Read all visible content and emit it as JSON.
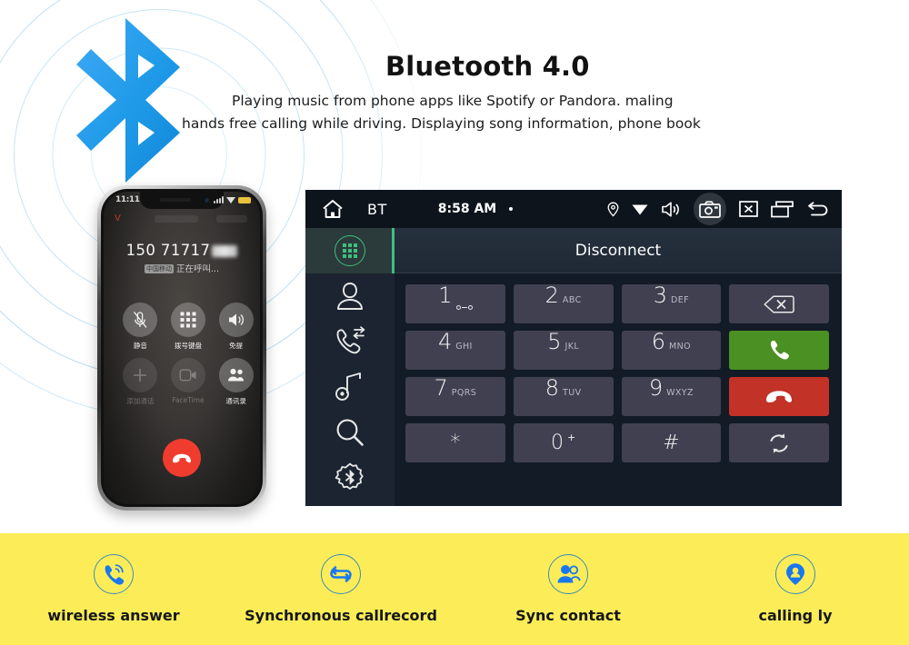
{
  "hero": {
    "title": "Bluetooth 4.0",
    "desc_line1": "Playing music from phone apps like Spotify or Pandora. maling",
    "desc_line2": "hands free calling while driving. Displaying  song information, phone book",
    "logo_icon": "bluetooth-logo-icon",
    "accent_blue": "#2196f3",
    "ring_color": "#bfe3f5"
  },
  "phone": {
    "status": {
      "time": "11:11",
      "carrier_mark": "V",
      "battery_color": "#e8c33c"
    },
    "call": {
      "number": "150 71717",
      "number_masked": true,
      "status_tag": "中国移动",
      "status_text": "正在呼叫...",
      "end_call_icon": "end-call-icon",
      "end_call_color": "#f03c2e"
    },
    "buttons": [
      {
        "label": "静音",
        "icon": "mute-icon",
        "dim": false
      },
      {
        "label": "拨号键盘",
        "icon": "keypad-icon",
        "dim": false
      },
      {
        "label": "免提",
        "icon": "speaker-icon",
        "dim": false
      },
      {
        "label": "添加通话",
        "icon": "add-call-icon",
        "dim": true
      },
      {
        "label": "FaceTime",
        "icon": "facetime-icon",
        "dim": true
      },
      {
        "label": "通讯录",
        "icon": "contacts-icon",
        "dim": false
      }
    ]
  },
  "headunit": {
    "topbar": {
      "home_icon": "home-icon",
      "source_label": "BT",
      "time": "8:58 AM",
      "dot": "•",
      "icons": [
        "location-pin-icon",
        "wifi-icon",
        "volume-icon",
        "camera-icon",
        "close-box-icon",
        "recent-apps-icon",
        "back-arrow-icon"
      ]
    },
    "sidebar": [
      {
        "name": "dialpad",
        "icon": "dialpad-icon",
        "active": true
      },
      {
        "name": "contacts",
        "icon": "contact-icon",
        "active": false
      },
      {
        "name": "call-history",
        "icon": "call-history-icon",
        "active": false
      },
      {
        "name": "music",
        "icon": "music-note-icon",
        "active": false
      },
      {
        "name": "search",
        "icon": "search-icon",
        "active": false
      },
      {
        "name": "bluetooth-settings",
        "icon": "bluetooth-gear-icon",
        "active": false
      }
    ],
    "header_title": "Disconnect",
    "keys": [
      {
        "num": "1",
        "sub": "",
        "voicemail": true
      },
      {
        "num": "2",
        "sub": "ABC"
      },
      {
        "num": "3",
        "sub": "DEF"
      },
      {
        "type": "action",
        "icon": "backspace-icon"
      },
      {
        "num": "4",
        "sub": "GHI"
      },
      {
        "num": "5",
        "sub": "JKL"
      },
      {
        "num": "6",
        "sub": "MNO"
      },
      {
        "type": "green",
        "icon": "call-icon"
      },
      {
        "num": "7",
        "sub": "PQRS"
      },
      {
        "num": "8",
        "sub": "TUV"
      },
      {
        "num": "9",
        "sub": "WXYZ"
      },
      {
        "type": "red",
        "icon": "hangup-icon"
      },
      {
        "num": "*",
        "sub": "",
        "symbol": true
      },
      {
        "num": "0",
        "sup": "+",
        "symbol": true
      },
      {
        "num": "#",
        "sub": "",
        "symbol": true
      },
      {
        "type": "action",
        "icon": "sync-icon"
      }
    ],
    "colors": {
      "background": "#121b26",
      "topbar": "#0d141c",
      "sidebar": "#1b2430",
      "key": "#414050",
      "accent_green": "#3fbf7f",
      "call_green": "#4a9022",
      "hangup_red": "#c23226"
    }
  },
  "features": {
    "background": "#fced58",
    "icon_color": "#1878f0",
    "items": [
      {
        "label": "wireless answer",
        "icon": "wireless-call-icon"
      },
      {
        "label": "Synchronous callrecord",
        "icon": "sync-loop-icon"
      },
      {
        "label": "Sync contact",
        "icon": "contacts-pair-icon"
      },
      {
        "label": "calling ly",
        "icon": "caller-location-icon"
      }
    ]
  }
}
